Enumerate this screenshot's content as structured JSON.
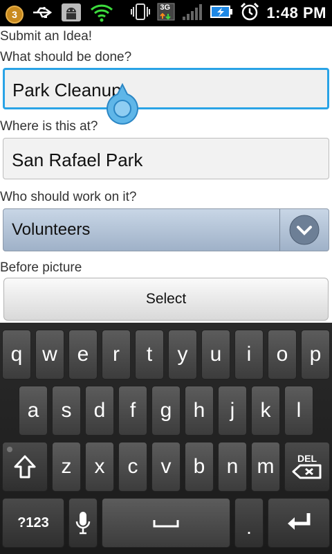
{
  "status_bar": {
    "notification_count": "3",
    "network_type": "3G",
    "time": "1:48 PM"
  },
  "form": {
    "title": "Submit an Idea!",
    "what_label": "What should be done?",
    "what_value": "Park Cleanup",
    "where_label": "Where is this at?",
    "where_value": "San Rafael Park",
    "who_label": "Who should work on it?",
    "who_value": "Volunteers",
    "before_picture_label": "Before picture",
    "select_button_label": "Select"
  },
  "keyboard": {
    "row1": [
      "q",
      "w",
      "e",
      "r",
      "t",
      "y",
      "u",
      "i",
      "o",
      "p"
    ],
    "row2": [
      "a",
      "s",
      "d",
      "f",
      "g",
      "h",
      "j",
      "k",
      "l"
    ],
    "row3": [
      "z",
      "x",
      "c",
      "v",
      "b",
      "n",
      "m"
    ],
    "del_label": "DEL",
    "symbols_label": "?123",
    "period_label": "."
  },
  "colors": {
    "focus_border": "#29a3e6",
    "spinner_top": "#c8d6e6",
    "spinner_bottom": "#9fb1c8"
  }
}
